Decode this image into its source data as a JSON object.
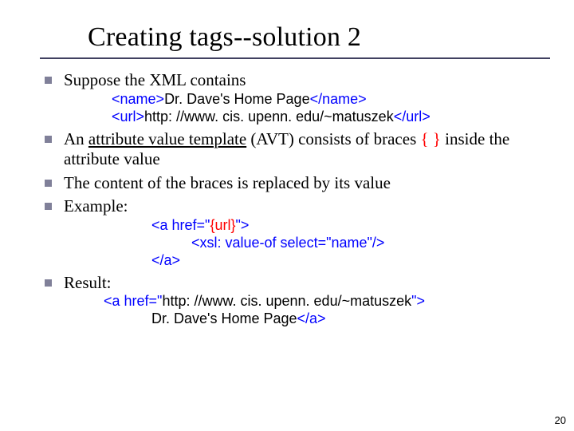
{
  "title": "Creating tags--solution 2",
  "bullets": {
    "b1": "Suppose the XML contains",
    "code1a_pre": "<name>",
    "code1a_mid": "Dr. Dave's Home Page",
    "code1a_post": "</name>",
    "code1b_pre": "<url>",
    "code1b_mid": "http: //www. cis. upenn. edu/~matuszek",
    "code1b_post": "</url>",
    "b2_a": "An ",
    "b2_b": "attribute value template",
    "b2_c": " (AVT) consists of braces ",
    "b2_d": "{ }",
    "b2_e": " inside the attribute value",
    "b3": "The content of the braces is replaced by its value",
    "b4": "Example:",
    "ex1": "<a href=\"",
    "ex1_mid": "{url}",
    "ex1_end": "\">",
    "ex2": "<xsl: value-of select=\"name\"/>",
    "ex3": "</a>",
    "b5": "Result:",
    "r1_a": "<a href=\"",
    "r1_b": "http: //www. cis. upenn. edu/~matuszek",
    "r1_c": "\">",
    "r2_a": "Dr. Dave's Home Page",
    "r2_b": "</a>"
  },
  "page_number": "20"
}
